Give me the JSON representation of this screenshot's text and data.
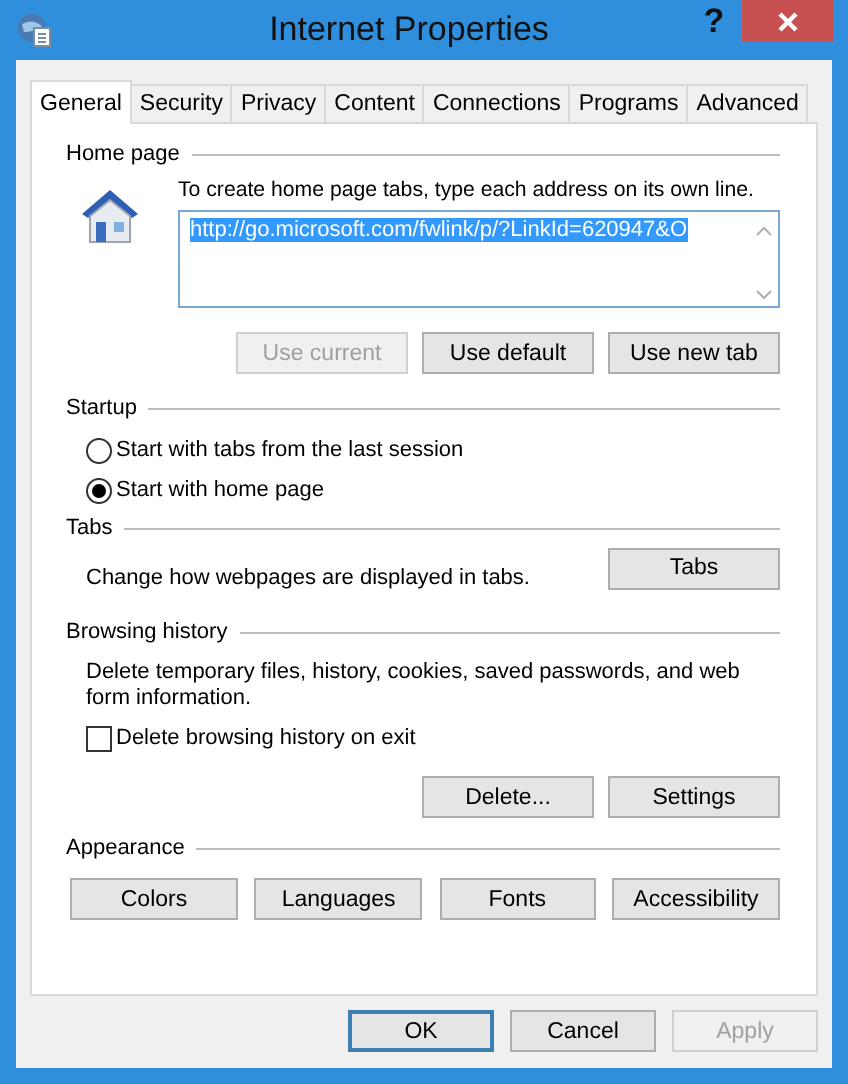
{
  "window": {
    "title": "Internet Properties",
    "help": "?"
  },
  "tabs": [
    {
      "label": "General",
      "selected": true
    },
    {
      "label": "Security",
      "selected": false
    },
    {
      "label": "Privacy",
      "selected": false
    },
    {
      "label": "Content",
      "selected": false
    },
    {
      "label": "Connections",
      "selected": false
    },
    {
      "label": "Programs",
      "selected": false
    },
    {
      "label": "Advanced",
      "selected": false
    }
  ],
  "home_page": {
    "heading": "Home page",
    "description": "To create home page tabs, type each address on its own line.",
    "url": "http://go.microsoft.com/fwlink/p/?LinkId=620947&O",
    "url_highlighted": true,
    "buttons": [
      {
        "label": "Use current",
        "disabled": true
      },
      {
        "label": "Use default",
        "disabled": false
      },
      {
        "label": "Use new tab",
        "disabled": false
      }
    ]
  },
  "startup": {
    "heading": "Startup",
    "options": [
      {
        "label": "Start with tabs from the last session",
        "selected": false
      },
      {
        "label": "Start with home page",
        "selected": true
      }
    ]
  },
  "tabs_section": {
    "heading": "Tabs",
    "description": "Change how webpages are displayed in tabs.",
    "button": "Tabs"
  },
  "browsing_history": {
    "heading": "Browsing history",
    "description": "Delete temporary files, history, cookies, saved passwords, and web form information.",
    "delete_on_exit": {
      "label": "Delete browsing history on exit",
      "checked": false
    },
    "buttons": [
      {
        "label": "Delete...",
        "disabled": false
      },
      {
        "label": "Settings",
        "disabled": false
      }
    ]
  },
  "appearance": {
    "heading": "Appearance",
    "buttons": [
      {
        "label": "Colors",
        "disabled": false
      },
      {
        "label": "Languages",
        "disabled": false
      },
      {
        "label": "Fonts",
        "disabled": false
      },
      {
        "label": "Accessibility",
        "disabled": false
      }
    ]
  },
  "footer_buttons": [
    {
      "label": "OK",
      "disabled": false,
      "default": true
    },
    {
      "label": "Cancel",
      "disabled": false,
      "default": false
    },
    {
      "label": "Apply",
      "disabled": true,
      "default": false
    }
  ]
}
